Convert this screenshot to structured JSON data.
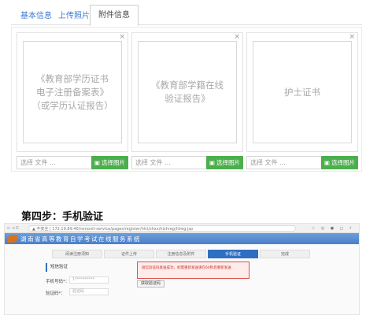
{
  "tabs": [
    {
      "label": "基本信息"
    },
    {
      "label": "上传照片"
    },
    {
      "label": "附件信息"
    }
  ],
  "attachments": [
    {
      "text": "《教育部学历证书\n电子注册备案表》\n（或学历认证报告）"
    },
    {
      "text": "《教育部学籍在线\n验证报告》"
    },
    {
      "text": "护士证书"
    }
  ],
  "file_input": {
    "placeholder": "选择 文件 ...",
    "button_label": "选择图片"
  },
  "close_glyph": "×",
  "step_heading": "第四步：手机验证",
  "browser": {
    "nav": "← → C",
    "url": "▲ 不安全 | 172.19.89.40/rsmonit-service/pages/register/hlcl/zhxx/hlzhreg/hlreg.jsp",
    "tools": "☆ ◎ ● ◻ ⚡"
  },
  "site_title": "湖南省高等教育自学考试在线服务系统",
  "steps": [
    "阅读注册须知",
    "证件上传",
    "注册信息及附件",
    "手机验证",
    "完成"
  ],
  "active_step": 3,
  "sidebar_tab": "短信验证",
  "form": {
    "phone_label": "手机号码*：",
    "phone_value": "1**********",
    "code_label": "验证码*：",
    "code_placeholder": "验证码"
  },
  "alert_text": "短信验证码发送成功，如需重新发送请在60秒后重新发送",
  "send_code_button": "获取验证码",
  "colors": {
    "accent": "#3a7ad4",
    "green": "#4cae4c",
    "step_active": "#2f6fc2",
    "alert_red": "#d9534f"
  }
}
